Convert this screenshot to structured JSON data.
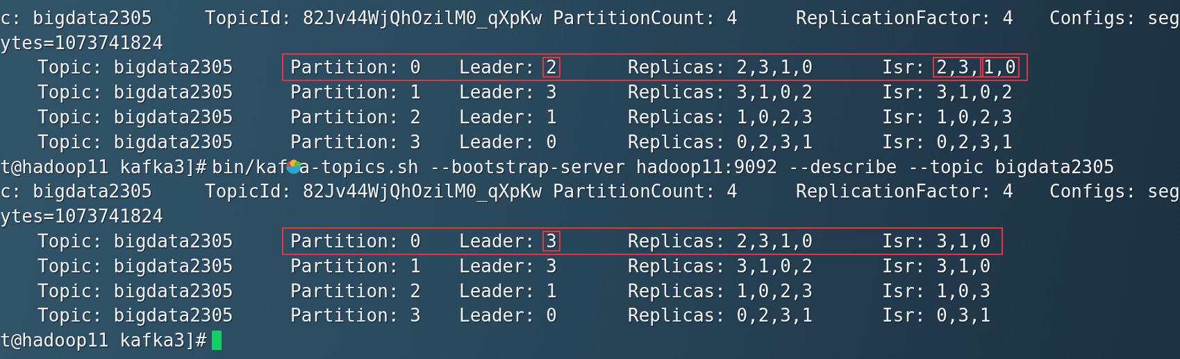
{
  "lines": [
    {
      "kind": "info",
      "topic": "c: bigdata2305",
      "topic_id": "TopicId: 82Jv44WjQhOzilM0_qXpKw PartitionCount: 4",
      "replication": "ReplicationFactor: 4",
      "configs": "Configs: seg"
    },
    {
      "kind": "wrap",
      "text": "ytes=1073741824"
    },
    {
      "kind": "partition",
      "topic": "Topic: bigdata2305",
      "partition": "Partition: 0",
      "leader_label": "Leader:",
      "leader": "2",
      "leader_boxed": true,
      "replicas": "Replicas: 2,3,1,0",
      "isr_label": "Isr:",
      "isr": [
        {
          "text": "2,3,",
          "boxed": true
        },
        {
          "text": "1,0",
          "boxed": true
        }
      ],
      "highlighted": true
    },
    {
      "kind": "partition",
      "topic": "Topic: bigdata2305",
      "partition": "Partition: 1",
      "leader_label": "Leader:",
      "leader": "3",
      "leader_boxed": false,
      "replicas": "Replicas: 3,1,0,2",
      "isr_label": "Isr:",
      "isr": [
        {
          "text": "3,1,0,2",
          "boxed": false
        }
      ],
      "highlighted": false
    },
    {
      "kind": "partition",
      "topic": "Topic: bigdata2305",
      "partition": "Partition: 2",
      "leader_label": "Leader:",
      "leader": "1",
      "leader_boxed": false,
      "replicas": "Replicas: 1,0,2,3",
      "isr_label": "Isr:",
      "isr": [
        {
          "text": "1,0,2,3",
          "boxed": false
        }
      ],
      "highlighted": false
    },
    {
      "kind": "partition",
      "topic": "Topic: bigdata2305",
      "partition": "Partition: 3",
      "leader_label": "Leader:",
      "leader": "0",
      "leader_boxed": false,
      "replicas": "Replicas: 0,2,3,1",
      "isr_label": "Isr:",
      "isr": [
        {
          "text": "0,2,3,1",
          "boxed": false
        }
      ],
      "highlighted": false
    },
    {
      "kind": "command",
      "prompt": "t@hadoop11 kafka3]#",
      "before": "bin/kaf",
      "after": "a-topics.sh --bootstrap-server hadoop11:9092 --describe --topic bigdata2305"
    },
    {
      "kind": "info",
      "topic": "c: bigdata2305",
      "topic_id": "TopicId: 82Jv44WjQhOzilM0_qXpKw PartitionCount: 4",
      "replication": "ReplicationFactor: 4",
      "configs": "Configs: seg"
    },
    {
      "kind": "wrap",
      "text": "ytes=1073741824"
    },
    {
      "kind": "partition",
      "topic": "Topic: bigdata2305",
      "partition": "Partition: 0",
      "leader_label": "Leader:",
      "leader": "3",
      "leader_boxed": true,
      "replicas": "Replicas: 2,3,1,0",
      "isr_label": "Isr:",
      "isr": [
        {
          "text": "3,1,0",
          "boxed": false
        }
      ],
      "highlighted": true
    },
    {
      "kind": "partition",
      "topic": "Topic: bigdata2305",
      "partition": "Partition: 1",
      "leader_label": "Leader:",
      "leader": "3",
      "leader_boxed": false,
      "replicas": "Replicas: 3,1,0,2",
      "isr_label": "Isr:",
      "isr": [
        {
          "text": "3,1,0",
          "boxed": false
        }
      ],
      "highlighted": false
    },
    {
      "kind": "partition",
      "topic": "Topic: bigdata2305",
      "partition": "Partition: 2",
      "leader_label": "Leader:",
      "leader": "1",
      "leader_boxed": false,
      "replicas": "Replicas: 1,0,2,3",
      "isr_label": "Isr:",
      "isr": [
        {
          "text": "1,0,3",
          "boxed": false
        }
      ],
      "highlighted": false
    },
    {
      "kind": "partition",
      "topic": "Topic: bigdata2305",
      "partition": "Partition: 3",
      "leader_label": "Leader:",
      "leader": "0",
      "leader_boxed": false,
      "replicas": "Replicas: 0,2,3,1",
      "isr_label": "Isr:",
      "isr": [
        {
          "text": "0,3,1",
          "boxed": false
        }
      ],
      "highlighted": false
    },
    {
      "kind": "prompt",
      "prompt": "t@hadoop11 kafka3]#",
      "cursor": true
    }
  ]
}
